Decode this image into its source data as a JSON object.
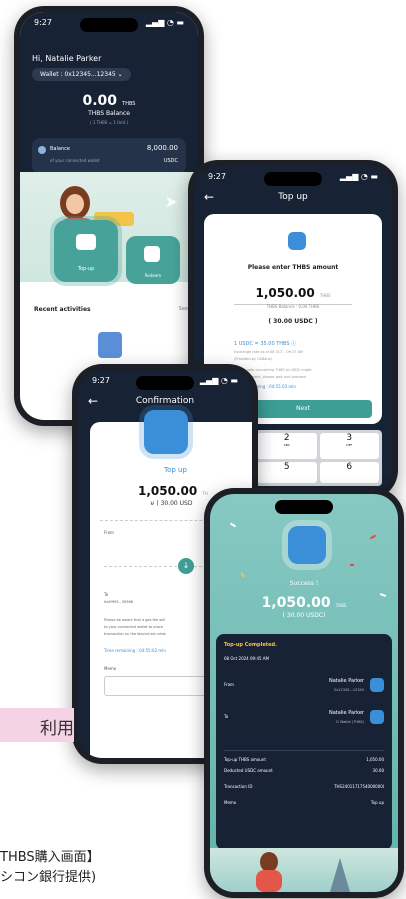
{
  "phone1": {
    "time": "9:27",
    "signal": "▂▄▆ ◔ ▬",
    "greeting": "Hi, Natalie Parker",
    "wallet_chip": "Wallet : 0x12345...12345",
    "balance_value": "0.00",
    "balance_unit": "THBS",
    "balance_label": "THBS Balance",
    "rate_line": "( 1 THBS = 1 Unit )",
    "card_label": "Balance",
    "card_sub": "of your connected wallet",
    "card_value": "8,000.00",
    "card_unit": "USDC",
    "tile1": "Top-up",
    "tile2": "Redeem",
    "recent": "Recent activities",
    "see_all": "See"
  },
  "phone2": {
    "time": "9:27",
    "title": "Top up",
    "prompt": "Please enter THBS amount",
    "amount": "1,050.00",
    "amount_unit": "THBS",
    "balance_line": "THBS Balance : 0.00 THBS",
    "usdc": "( 30.00 USDC )",
    "rate": "1 USDC = 35.00 THBS ⓘ",
    "note1": "Exchange rate as of 08 OCT - 09:27 AM",
    "note2": "(Provided by USBank)",
    "note3": "Please note converting THBS to USDC might",
    "note4": "take a moment, please wait and proceed",
    "timer": "Time remaining : 04:55:03 min",
    "next": "Next",
    "keys": [
      {
        "n": "2",
        "s": "ABC"
      },
      {
        "n": "3",
        "s": "DEF"
      },
      {
        "n": "5",
        "s": ""
      },
      {
        "n": "6",
        "s": ""
      }
    ]
  },
  "phone3": {
    "time": "9:27",
    "title": "Confirmation",
    "heading": "Top up",
    "amount": "1,050.00",
    "amount_unit": "TH",
    "usdc": "( 30.00 USD",
    "from_label": "From",
    "from_name": "Natal",
    "from_addr": "0x123",
    "to_label": "To",
    "to_addr": "0x0f993...39368",
    "to_name": "Natal",
    "to_wallet": "G Wall",
    "note1": "Please be aware that a gas fee will",
    "note2": "to your connected wallet to proce",
    "note3": "transaction on the blockchain netw",
    "timer": "Time remaining : 04:55:02 min",
    "memo": "Memo"
  },
  "phone4": {
    "status": "Success !",
    "amount": "1,050.00",
    "amount_unit": "THBS",
    "usdc": "( 30.00 USDC)",
    "completed": "Top-up Completed.",
    "date": "08 Oct 2024 09:45 AM",
    "from_label": "From",
    "from_name": "Natalie Parker",
    "from_addr": "0x12345...12345",
    "to_label": "To",
    "to_name": "Natalie Parker",
    "to_wallet": "G Wallet (THBS)",
    "rows": [
      {
        "k": "Top-up THBS amount",
        "v": "1,050.00"
      },
      {
        "k": "Deducted USDC amount",
        "v": "30.00"
      },
      {
        "k": "Transaction ID",
        "v": "THS2401171754000000I"
      },
      {
        "k": "Memo",
        "v": "Top up"
      }
    ]
  },
  "caption": {
    "tag": "利用",
    "line1": "THBS購入画面】",
    "line2": "シコン銀行提供)"
  },
  "colors": {
    "dark": "#152033",
    "teal": "#3d9e96",
    "blue": "#3a8fd8",
    "pink": "#f3d3e4"
  }
}
